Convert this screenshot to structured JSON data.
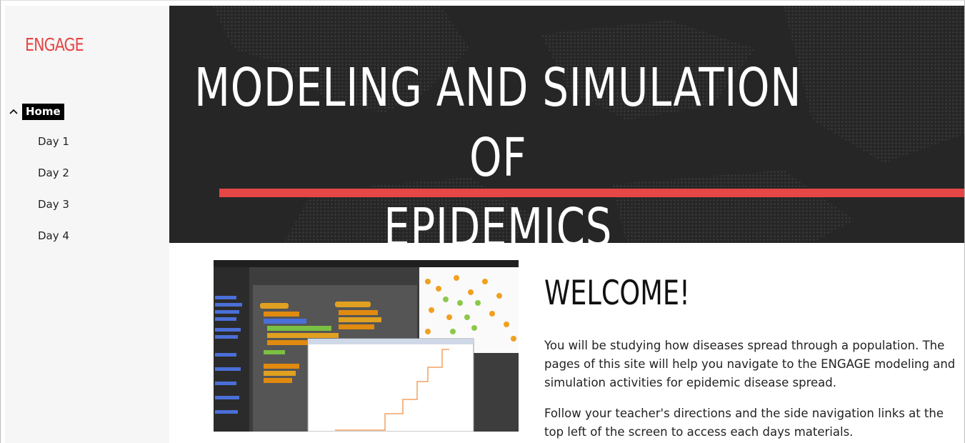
{
  "sidebar": {
    "brand": "ENGAGE",
    "home_label": "Home",
    "items": [
      {
        "label": "Day 1"
      },
      {
        "label": "Day 2"
      },
      {
        "label": "Day 3"
      },
      {
        "label": "Day 4"
      }
    ]
  },
  "hero": {
    "title_line1": "MODELING AND SIMULATION OF",
    "title_line2": "EPIDEMICS",
    "accent_color": "#e64646"
  },
  "main": {
    "heading": "WELCOME!",
    "paragraphs": [
      "You will be studying how diseases spread through a population. The pages of this site will help you navigate to the ENGAGE modeling and simulation activities for epidemic disease spread.",
      "Follow your teacher's directions and the side navigation links at the top left of the screen to access each days materials."
    ]
  }
}
